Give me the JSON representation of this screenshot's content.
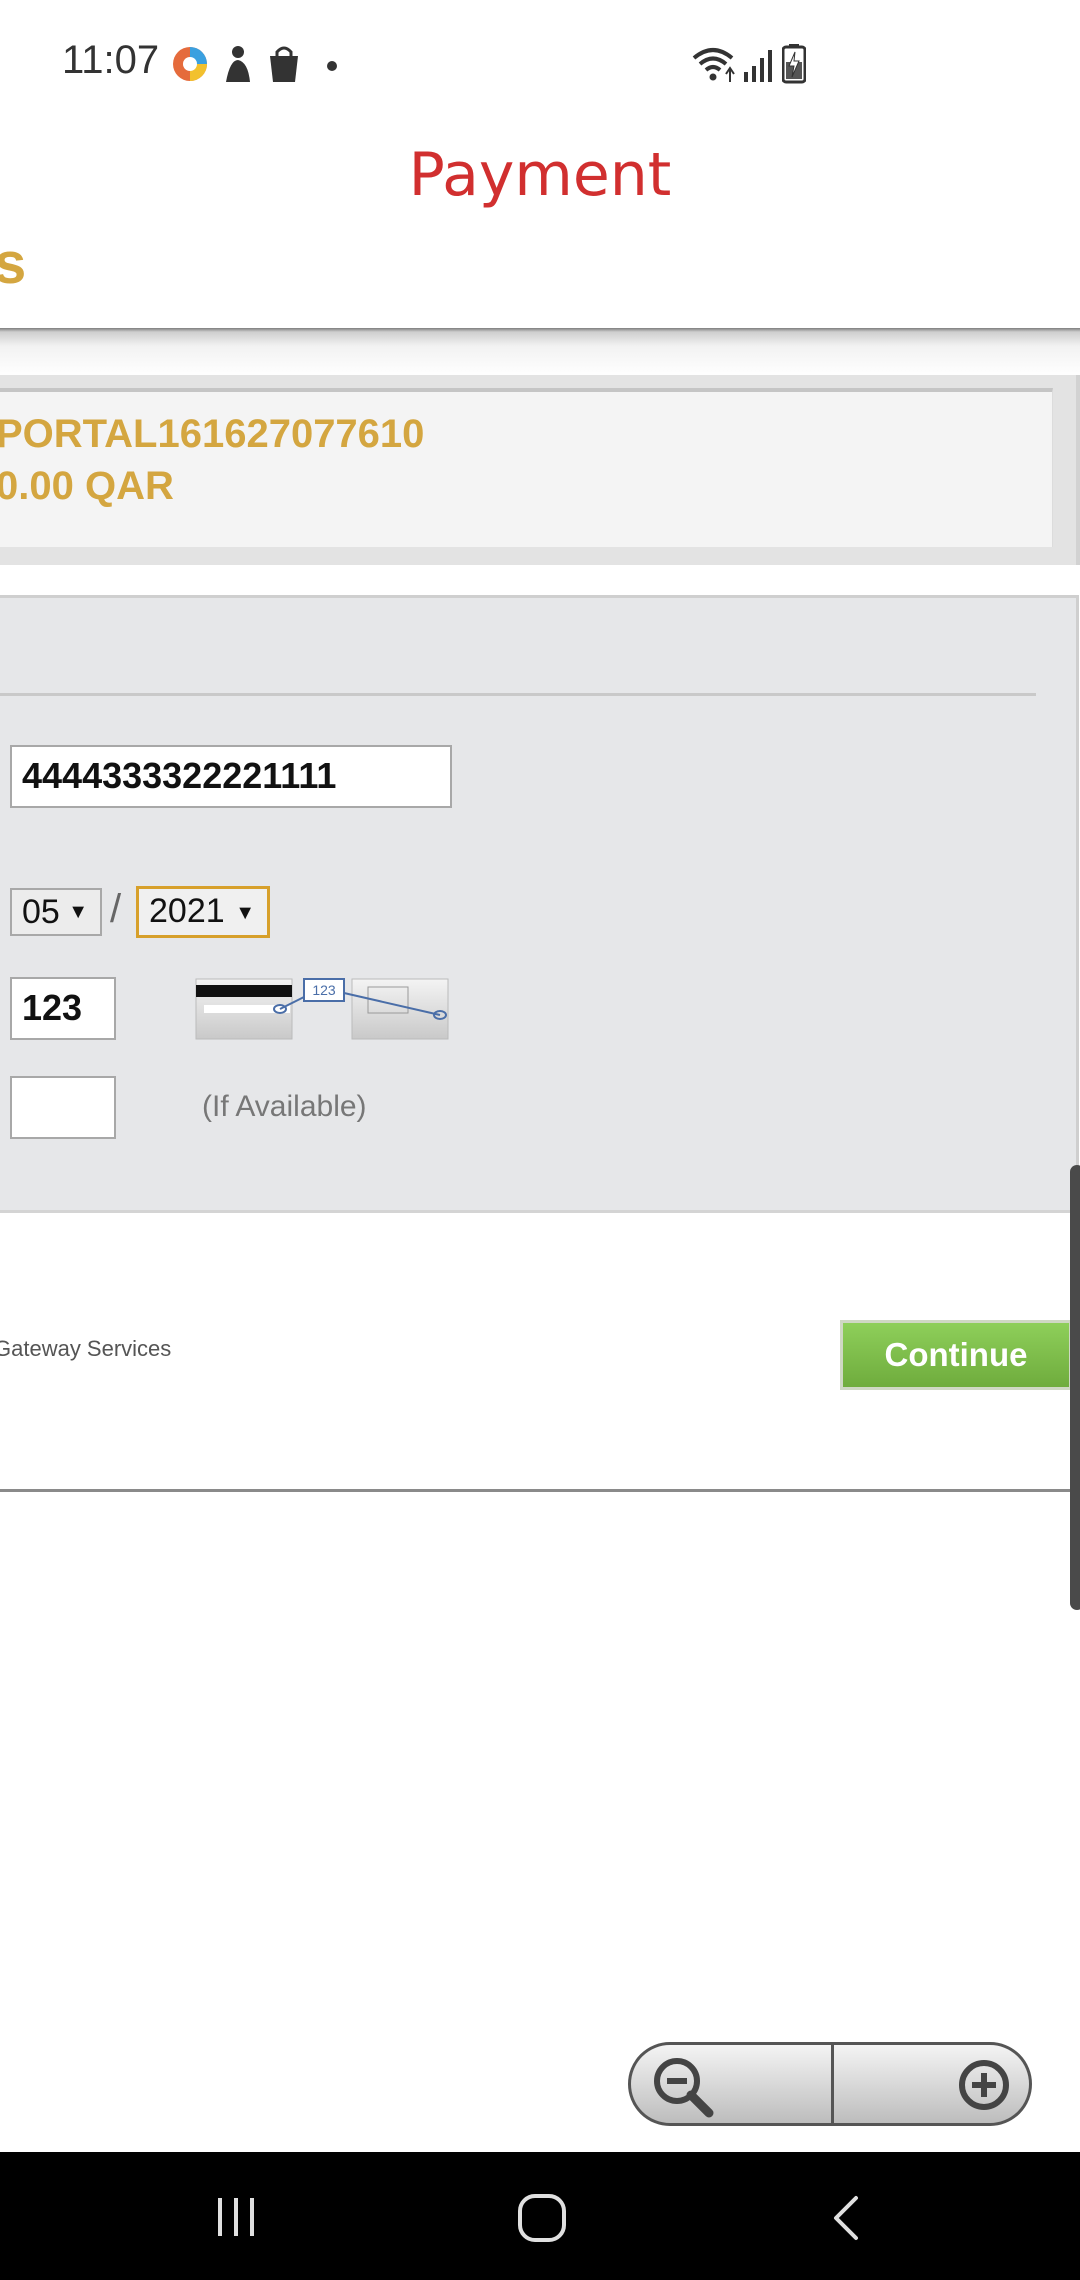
{
  "status_bar": {
    "time": "11:07",
    "icons": [
      "app-notification-icon",
      "app-notification-icon-2",
      "shopping-bag-icon",
      "dot-icon",
      "wifi-icon",
      "signal-icon",
      "battery-charging-icon"
    ]
  },
  "header": {
    "title": "Payment",
    "cut_text": "s"
  },
  "order": {
    "reference": "PORTAL161627077610",
    "amount": "0.00 QAR"
  },
  "form": {
    "card_number": "4444333322221111",
    "expiry_month": "05",
    "expiry_separator": "/",
    "expiry_year": "2021",
    "cvv": "123",
    "cvv_hint_number": "123",
    "optional_field_value": "",
    "optional_hint": "(If Available)"
  },
  "footer": {
    "gateway_text": "Gateway Services",
    "continue_label": "Continue"
  },
  "zoom": {
    "zoom_out_icon": "zoom-out-icon",
    "zoom_in_icon": "zoom-in-icon"
  },
  "nav_bar": {
    "icons": [
      "recent-apps-icon",
      "home-icon",
      "back-icon"
    ]
  },
  "colors": {
    "title_red": "#d12f2f",
    "accent_gold": "#d4a640",
    "continue_green": "#7ab948",
    "panel_grey": "#e6e7e9"
  }
}
